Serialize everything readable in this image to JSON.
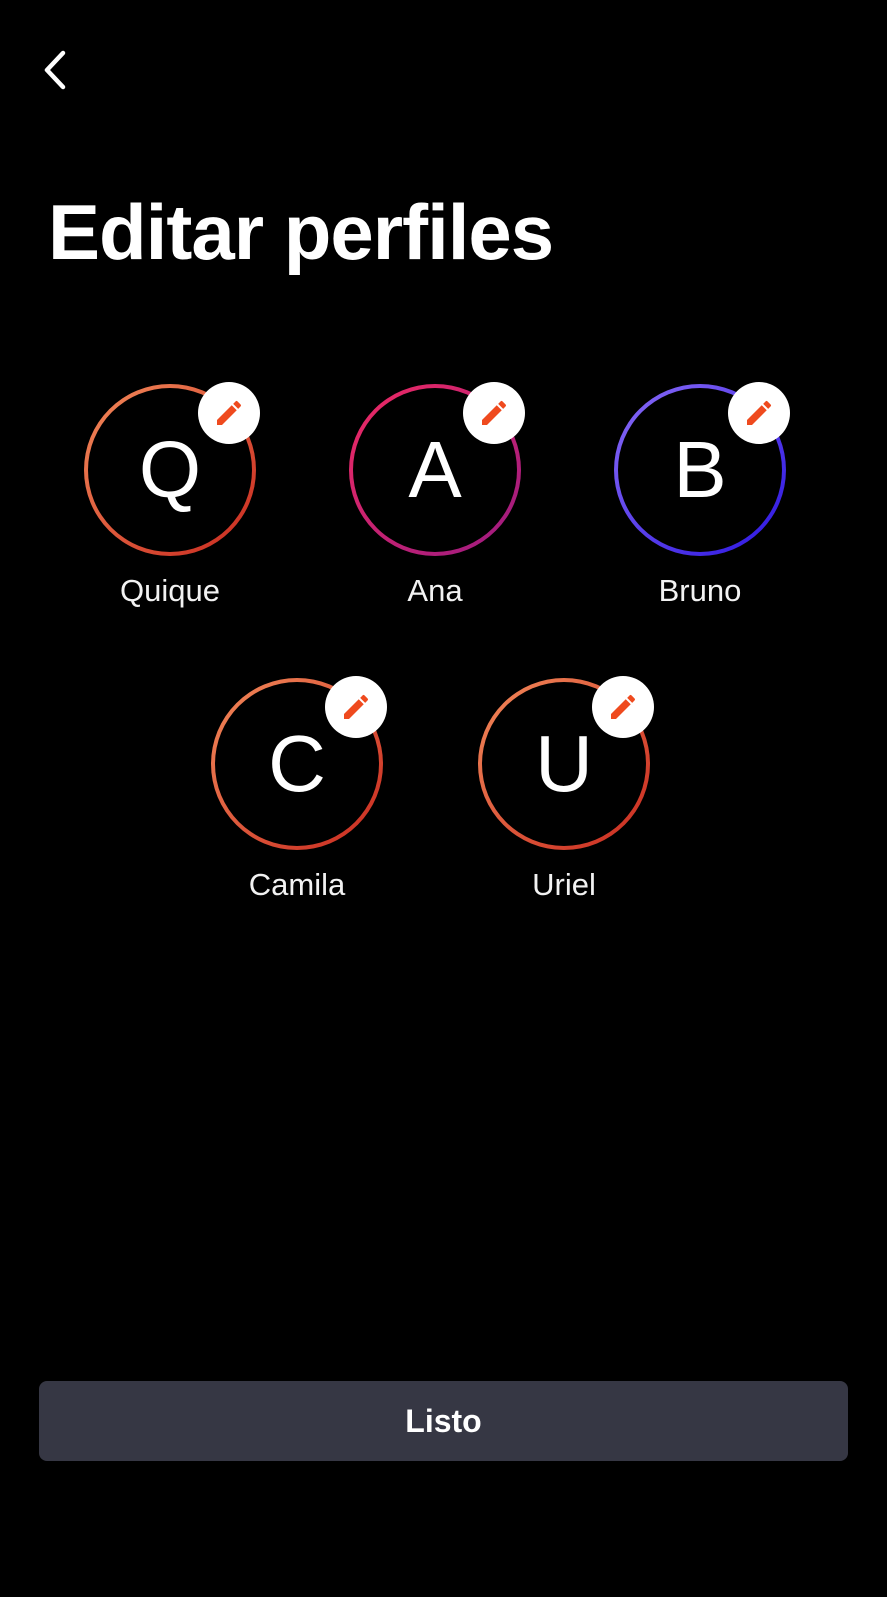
{
  "header": {
    "back_icon": "chevron-left-icon",
    "title": "Editar perfiles"
  },
  "profiles": [
    {
      "initial": "Q",
      "name": "Quique",
      "ring_colors": [
        "#f28a5a",
        "#c8281e"
      ],
      "edit_icon": "pencil-icon"
    },
    {
      "initial": "A",
      "name": "Ana",
      "ring_colors": [
        "#f02a62",
        "#9a1a82"
      ],
      "edit_icon": "pencil-icon"
    },
    {
      "initial": "B",
      "name": "Bruno",
      "ring_colors": [
        "#8a6cf6",
        "#2a14e0"
      ],
      "edit_icon": "pencil-icon"
    },
    {
      "initial": "C",
      "name": "Camila",
      "ring_colors": [
        "#f28a5a",
        "#c8281e"
      ],
      "edit_icon": "pencil-icon"
    },
    {
      "initial": "U",
      "name": "Uriel",
      "ring_colors": [
        "#f28a5a",
        "#c8281e"
      ],
      "edit_icon": "pencil-icon"
    }
  ],
  "edit_icon_color": "#ef4a1e",
  "footer": {
    "done_label": "Listo"
  }
}
